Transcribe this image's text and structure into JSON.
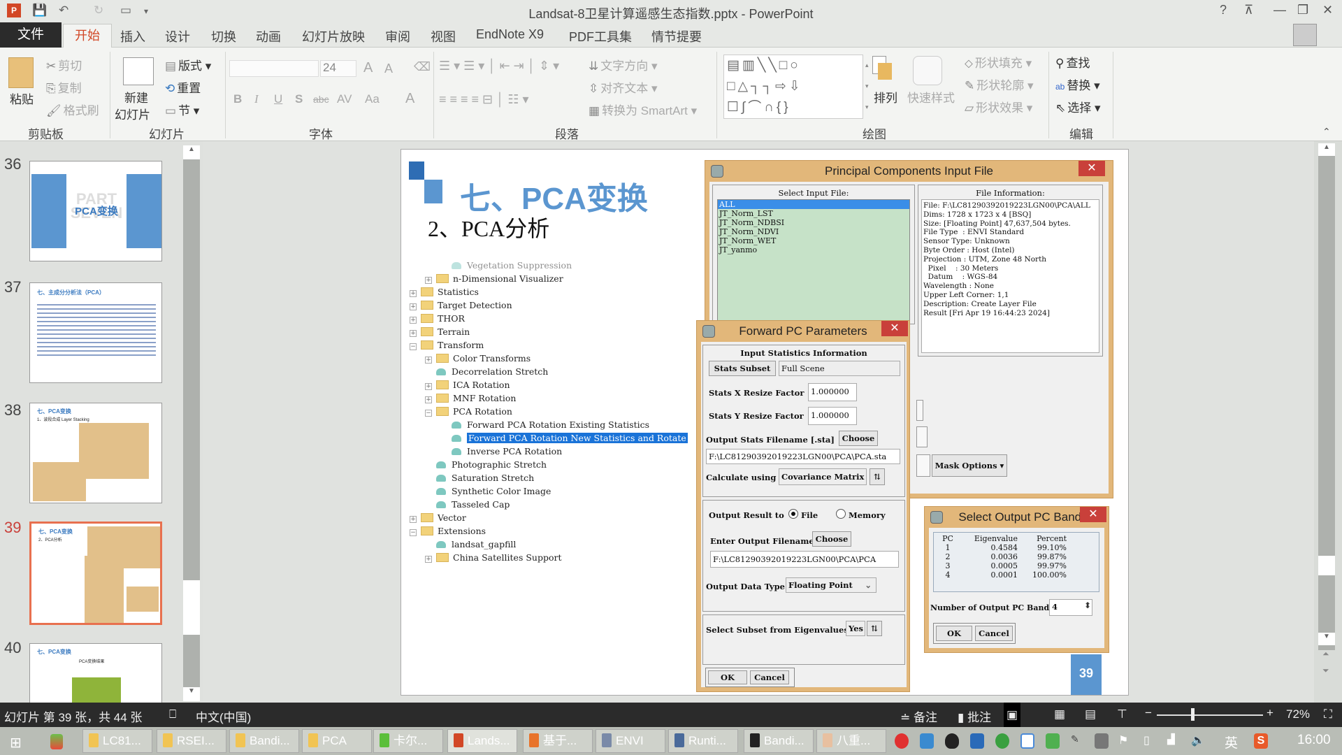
{
  "window": {
    "title": "Landsat-8卫星计算遥感生态指数.pptx - PowerPoint",
    "help": "?",
    "min": "—",
    "max": "❐",
    "close": "✕"
  },
  "tabs": [
    "文件",
    "开始",
    "插入",
    "设计",
    "切换",
    "动画",
    "幻灯片放映",
    "审阅",
    "视图",
    "EndNote X9",
    "PDF工具集",
    "情节提要"
  ],
  "ribbon": {
    "clipboard": {
      "paste": "粘贴",
      "cut": "剪切",
      "copy": "复制",
      "format_painter": "格式刷",
      "label": "剪贴板"
    },
    "slides": {
      "new_slide_1": "新建",
      "new_slide_2": "幻灯片",
      "layout": "版式",
      "reset": "重置",
      "section": "节",
      "label": "幻灯片"
    },
    "font": {
      "font_name": "",
      "font_size": "24",
      "bold": "B",
      "italic": "I",
      "underline": "U",
      "shadow": "S",
      "strike": "abc",
      "spacing": "AV",
      "case": "Aa",
      "color": "A",
      "grow": "A",
      "shrink": "A",
      "label": "字体"
    },
    "paragraph": {
      "text_direction": "文字方向",
      "align_text": "对齐文本",
      "smartart": "转换为 SmartArt",
      "label": "段落"
    },
    "drawing": {
      "arrange": "排列",
      "quick_styles": "快速样式",
      "shape_fill": "形状填充",
      "shape_outline": "形状轮廓",
      "shape_effects": "形状效果",
      "label": "绘图"
    },
    "editing": {
      "find": "查找",
      "replace": "替换",
      "select": "选择",
      "label": "编辑"
    }
  },
  "thumbnails": [
    {
      "num": "36",
      "title": "PCA变换",
      "bg": "PART SEVEN"
    },
    {
      "num": "37",
      "title": "七、主成分分析法（PCA）"
    },
    {
      "num": "38",
      "title": "七、PCA变换",
      "subtitle": "1、波段合成 Layer Stacking"
    },
    {
      "num": "39",
      "title": "七、PCA变换",
      "subtitle": "2、PCA分析",
      "selected": true
    },
    {
      "num": "40",
      "title": "七、PCA变换",
      "subtitle": "PCA变换结果"
    }
  ],
  "slide": {
    "title": "七、PCA变换",
    "subtitle": "2、PCA分析",
    "page_number": "39",
    "tree": [
      {
        "label": "Vegetation Suppression",
        "type": "tool",
        "level": 2
      },
      {
        "label": "n-Dimensional Visualizer",
        "type": "folder",
        "level": 1,
        "exp": "+"
      },
      {
        "label": "Statistics",
        "type": "folder",
        "level": 0,
        "exp": "+"
      },
      {
        "label": "Target Detection",
        "type": "folder",
        "level": 0,
        "exp": "+"
      },
      {
        "label": "THOR",
        "type": "folder",
        "level": 0,
        "exp": "+"
      },
      {
        "label": "Terrain",
        "type": "folder",
        "level": 0,
        "exp": "+"
      },
      {
        "label": "Transform",
        "type": "folder",
        "level": 0,
        "exp": "−"
      },
      {
        "label": "Color Transforms",
        "type": "folder",
        "level": 1,
        "exp": "+"
      },
      {
        "label": "Decorrelation Stretch",
        "type": "tool",
        "level": 1
      },
      {
        "label": "ICA Rotation",
        "type": "folder",
        "level": 1,
        "exp": "+"
      },
      {
        "label": "MNF Rotation",
        "type": "folder",
        "level": 1,
        "exp": "+"
      },
      {
        "label": "PCA Rotation",
        "type": "folder",
        "level": 1,
        "exp": "−"
      },
      {
        "label": "Forward PCA Rotation Existing Statistics",
        "type": "tool",
        "level": 2
      },
      {
        "label": "Forward PCA Rotation New Statistics and Rotate",
        "type": "tool",
        "level": 2,
        "selected": true
      },
      {
        "label": "Inverse PCA Rotation",
        "type": "tool",
        "level": 2
      },
      {
        "label": "Photographic Stretch",
        "type": "tool",
        "level": 1
      },
      {
        "label": "Saturation Stretch",
        "type": "tool",
        "level": 1
      },
      {
        "label": "Synthetic Color Image",
        "type": "tool",
        "level": 1
      },
      {
        "label": "Tasseled Cap",
        "type": "tool",
        "level": 1
      },
      {
        "label": "Vector",
        "type": "folder",
        "level": 0,
        "exp": "+"
      },
      {
        "label": "Extensions",
        "type": "folder",
        "level": 0,
        "exp": "−"
      },
      {
        "label": "landsat_gapfill",
        "type": "tool",
        "level": 1
      },
      {
        "label": "China Satellites Support",
        "type": "folder",
        "level": 1,
        "exp": "+"
      }
    ]
  },
  "pc_input": {
    "title": "Principal Components Input File",
    "select_label": "Select Input File:",
    "files": [
      "ALL",
      "JT_Norm_LST",
      "JT_Norm_NDBSI",
      "JT_Norm_NDVI",
      "JT_Norm_WET",
      "JT_yanmo"
    ],
    "selected_file": "ALL",
    "info_label": "File Information:",
    "info": [
      "File: F:\\LC81290392019223LGN00\\PCA\\ALL",
      "Dims: 1728 x 1723 x 4 [BSQ]",
      "Size: [Floating Point] 47,637,504 bytes.",
      "File Type  : ENVI Standard",
      "Sensor Type: Unknown",
      "Byte Order : Host (Intel)",
      "Projection : UTM, Zone 48 North",
      "  Pixel    : 30 Meters",
      "  Datum    : WGS-84",
      "Wavelength : None",
      "Upper Left Corner: 1,1",
      "Description: Create Layer File",
      "Result [Fri Apr 19 16:44:23 2024]"
    ],
    "mask_options": "Mask Options ▾"
  },
  "forward_pc": {
    "title": "Forward PC Parameters",
    "stats_header": "Input Statistics Information",
    "stats_subset_btn": "Stats Subset",
    "stats_subset_val": "Full Scene",
    "x_resize_label": "Stats X Resize Factor",
    "x_resize_val": "1.000000",
    "y_resize_label": "Stats Y Resize Factor",
    "y_resize_val": "1.000000",
    "out_stats_label": "Output Stats Filename [.sta]",
    "choose": "Choose",
    "out_stats_val": "F:\\LC81290392019223LGN00\\PCA\\PCA.sta",
    "calc_label": "Calculate using",
    "calc_val": "Covariance Matrix",
    "output_to_label": "Output Result to",
    "opt_file": "File",
    "opt_memory": "Memory",
    "output_to_selected": "File",
    "out_file_label": "Enter Output Filename",
    "out_file_val": "F:\\LC81290392019223LGN00\\PCA\\PCA",
    "dtype_label": "Output Data Type",
    "dtype_val": "Floating Point",
    "subset_eig_label": "Select Subset from Eigenvalues",
    "subset_eig_val": "Yes",
    "ok": "OK",
    "cancel": "Cancel"
  },
  "pc_bands": {
    "title": "Select Output PC Bands",
    "headers": [
      "PC",
      "Eigenvalue",
      "Percent"
    ],
    "rows": [
      [
        "1",
        "0.4584",
        "99.10%"
      ],
      [
        "2",
        "0.0036",
        "99.87%"
      ],
      [
        "3",
        "0.0005",
        "99.97%"
      ],
      [
        "4",
        "0.0001",
        "100.00%"
      ]
    ],
    "num_label": "Number of Output PC Bands",
    "num_val": "4",
    "ok": "OK",
    "cancel": "Cancel"
  },
  "status": {
    "slide_info": "幻灯片 第 39 张，共 44 张",
    "language": "中文(中国)",
    "notes": "备注",
    "comments": "批注",
    "zoom": "72%"
  },
  "taskbar": {
    "items": [
      "LC81...",
      "RSEI...",
      "Bandi...",
      "PCA",
      "卡尔...",
      "Lands...",
      "基于...",
      "ENVI",
      "Runti...",
      "Bandi...",
      "八重..."
    ],
    "ime": "英",
    "time": "16:00"
  }
}
